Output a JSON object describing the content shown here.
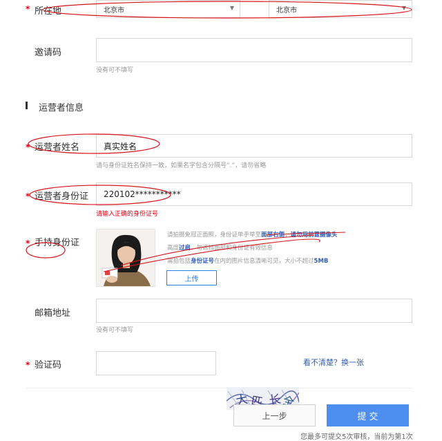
{
  "location": {
    "label": "所在地",
    "province": "北京市",
    "city": "北京市"
  },
  "invite": {
    "label": "邀请码",
    "value": "",
    "hint": "没有可不填写"
  },
  "section": {
    "title": "运营者信息"
  },
  "operator_name": {
    "label": "运营者姓名",
    "value": "真实姓名",
    "hint": "请与身份证姓名保持一致，如果名字包含分隔号“.”，请勿省略"
  },
  "operator_id": {
    "label": "运营者身份证",
    "value": "220102***********",
    "error": "请输入正确的身份证号"
  },
  "handheld_id": {
    "label": "手持身份证",
    "note1_pre": "请拍摄免冠正面照，身份证单手举至",
    "note1_b1": "面部右侧",
    "note1_mid": "，",
    "note1_b2": "请勿用前置摄像头",
    "note2_pre": "高度",
    "note2_b1": "过肩",
    "note2_post": "，勿遮挡面部和身份证有效信息",
    "note3_pre": "需拍包括",
    "note3_b1": "身份证号",
    "note3_post": "在内的图片信息清晰可见，大小不超过",
    "note3_b2": "5MB",
    "upload_label": "上传"
  },
  "email": {
    "label": "邮箱地址",
    "value": "",
    "hint": "没有可不填写"
  },
  "captcha": {
    "label": "验证码",
    "value": "",
    "refresh_link": "看不清楚？换一张"
  },
  "actions": {
    "prev_label": "上一步",
    "submit_label": "提 交"
  },
  "footer": {
    "text": "您最多可提交5次审核，当前为第1次"
  },
  "colors": {
    "required": "#e60012",
    "link": "#2f5bb7",
    "primary": "#4d8ef0",
    "annotation": "#d8141b"
  }
}
